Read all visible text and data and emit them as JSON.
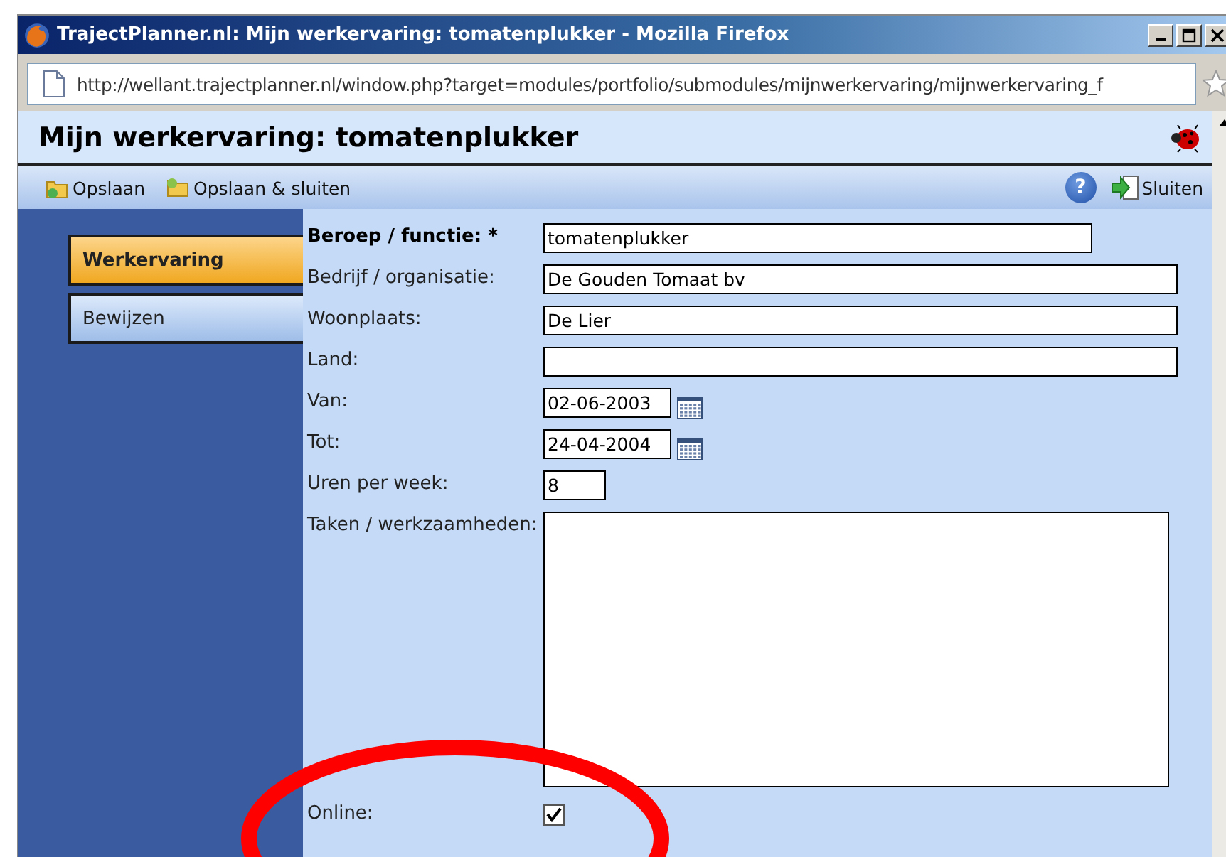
{
  "window": {
    "title": "TrajectPlanner.nl: Mijn werkervaring: tomatenplukker - Mozilla Firefox"
  },
  "address_bar": {
    "url": "http://wellant.trajectplanner.nl/window.php?target=modules/portfolio/submodules/mijnwerkervaring/mijnwerkervaring_f"
  },
  "page": {
    "title": "Mijn werkervaring: tomatenplukker"
  },
  "toolbar": {
    "left": [
      {
        "label": "Opslaan",
        "kind": "save"
      },
      {
        "label": "Opslaan & sluiten",
        "kind": "save-close"
      }
    ],
    "right": [
      {
        "kind": "help",
        "label": "?"
      },
      {
        "label": "Sluiten",
        "kind": "close"
      }
    ]
  },
  "nav_tabs": [
    {
      "label": "Werkervaring",
      "selected": true
    },
    {
      "label": "Bewijzen",
      "selected": false
    }
  ],
  "form": [
    {
      "label": "Beroep / functie: *",
      "kind": "text",
      "required": true,
      "value": "tomatenplukker"
    },
    {
      "label": "Bedrijf / organisatie:",
      "kind": "text",
      "required": false,
      "value": "De Gouden Tomaat bv"
    },
    {
      "label": "Woonplaats:",
      "kind": "text",
      "required": false,
      "value": "De Lier"
    },
    {
      "label": "Land:",
      "kind": "text",
      "required": false
    },
    {
      "label": "Van:",
      "kind": "date",
      "required": false,
      "value": "02-06-2003"
    },
    {
      "label": "Tot:",
      "kind": "date",
      "required": false,
      "value": "24-04-2004"
    },
    {
      "label": "Uren per week:",
      "kind": "text",
      "required": false,
      "value": "8"
    },
    {
      "label": "Taken / werkzaamheden:",
      "kind": "textarea",
      "required": false
    },
    {
      "label": "Online:",
      "kind": "checkbox",
      "required": false,
      "checked": true
    }
  ],
  "annotation": {
    "kind": "ellipse",
    "color": "#ff0000"
  }
}
